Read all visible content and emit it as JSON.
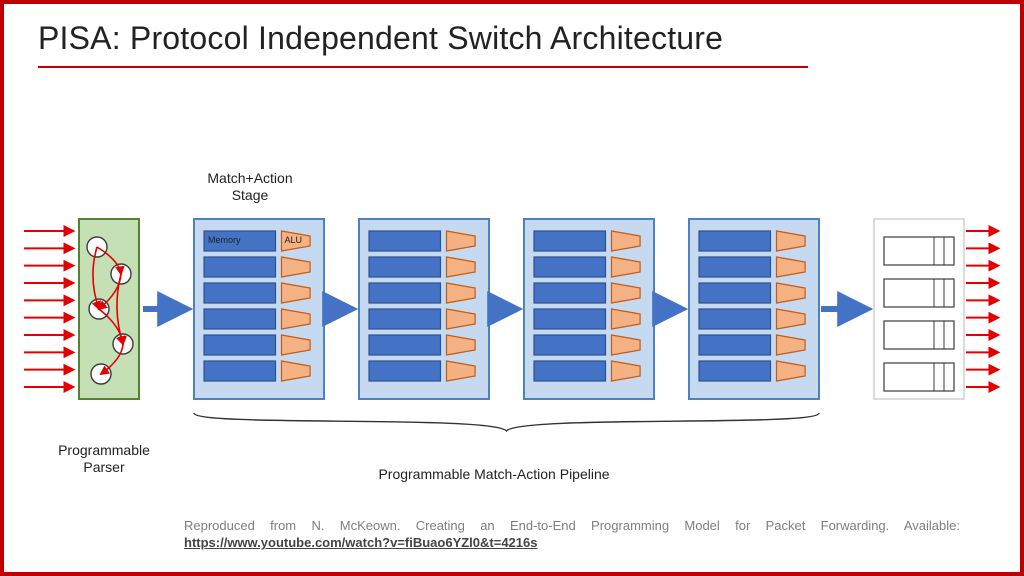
{
  "title": "PISA: Protocol Independent Switch Architecture",
  "labels": {
    "parser": "Programmable\nParser",
    "stage": "Match+Action\nStage",
    "pipeline": "Programmable Match-Action Pipeline",
    "memory": "Memory",
    "alu": "ALU"
  },
  "diagram": {
    "input_arrows": 10,
    "output_arrows": 10,
    "stages": 4,
    "rows_per_stage": 6,
    "queue_rows": 4,
    "parser_nodes": 5
  },
  "colors": {
    "border": "#c00000",
    "arrow_red": "#e30000",
    "arrow_blue": "#4472c4",
    "stage_bg": "#c5d9f1",
    "stage_border": "#4f81bd",
    "mem_fill": "#4472c4",
    "mem_stroke": "#2f528f",
    "alu_fill": "#f4b183",
    "alu_stroke": "#c55a11",
    "parser_fill": "#c5e0b4",
    "parser_stroke": "#548235",
    "node_stroke": "#3b3b3b",
    "queue_stroke": "#3b3b3b"
  },
  "citation": {
    "prefix": "Reproduced from N. McKeown. Creating an End-to-End Programming Model for Packet Forwarding. Available: ",
    "link_text": "https://www.youtube.com/watch?v=fiBuao6YZl0&t=4216s"
  }
}
